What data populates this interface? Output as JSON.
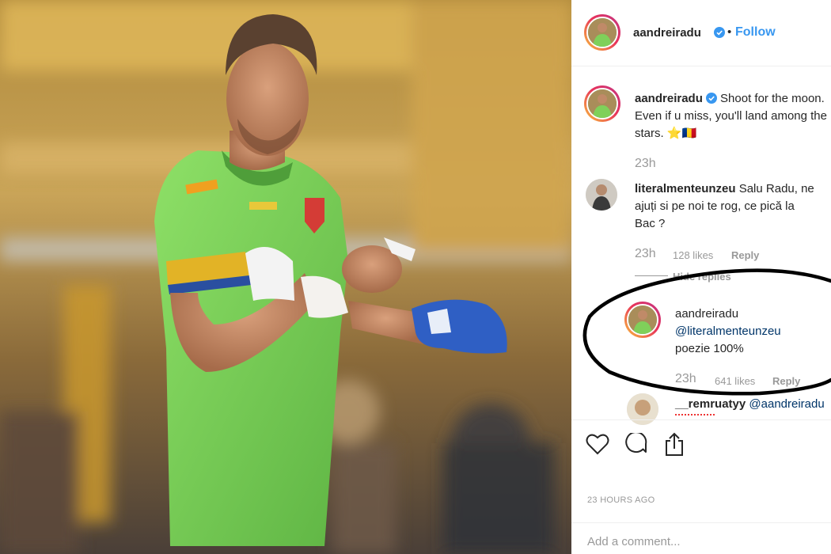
{
  "post": {
    "username": "aandreiradu",
    "follow_label": "Follow",
    "separator": "•"
  },
  "caption": {
    "username": "aandreiradu",
    "line1": "Shoot for the moon.",
    "line2": "Even if u miss, you'll land among the",
    "line3": "stars. ⭐🇷🇴",
    "time": "23h"
  },
  "comments": [
    {
      "username": "literalmenteunzeu",
      "line1": "Salu Radu, ne",
      "line2": "ajuți si pe noi te rog, ce pică la",
      "line3": "Bac ?",
      "time": "23h",
      "likes": "128 likes",
      "reply_label": "Reply",
      "hide_replies": "Hide replies"
    }
  ],
  "reply": {
    "username": "aandreiradu",
    "mention": "@literalmenteunzeu",
    "text": "poezie 100%",
    "time": "23h",
    "likes": "641 likes",
    "reply_label": "Reply"
  },
  "next_comment": {
    "username": "__remruatyy",
    "mention": "@aandreiradu"
  },
  "actions": {
    "like_icon": "heart-icon",
    "comment_icon": "speech-bubble-icon",
    "share_icon": "share-icon"
  },
  "timestamp": "23 HOURS AGO",
  "add_comment_placeholder": "Add a comment...",
  "colors": {
    "link": "#3897f0",
    "jersey": "#7fd05a",
    "annotation": "#000000"
  }
}
